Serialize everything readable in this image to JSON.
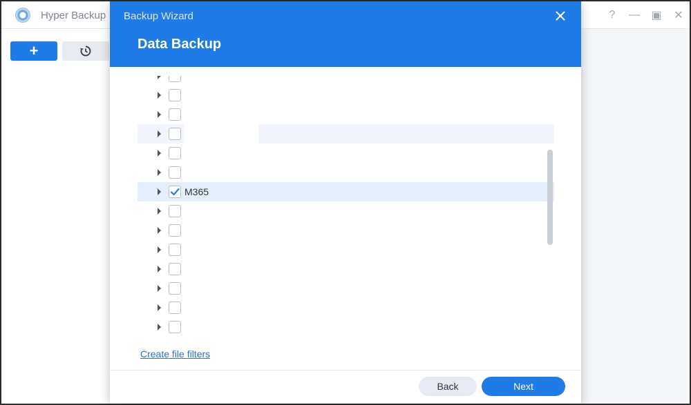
{
  "app": {
    "title": "Hyper Backup",
    "window_controls": [
      "?",
      "—",
      "▣",
      "✕"
    ],
    "sidebar": {
      "add_label": "+",
      "history_icon": "history-icon"
    }
  },
  "wizard": {
    "title": "Backup Wizard",
    "heading": "Data Backup",
    "close_icon": "close-icon",
    "tree_rows": [
      {
        "label": "",
        "checked": false,
        "state": "partial-top"
      },
      {
        "label": "",
        "checked": false
      },
      {
        "label": "",
        "checked": false
      },
      {
        "label": "",
        "checked": false,
        "state": "hover"
      },
      {
        "label": "",
        "checked": false
      },
      {
        "label": "",
        "checked": false
      },
      {
        "label": "M365",
        "checked": true,
        "state": "selected"
      },
      {
        "label": "",
        "checked": false
      },
      {
        "label": "",
        "checked": false
      },
      {
        "label": "",
        "checked": false
      },
      {
        "label": "",
        "checked": false
      },
      {
        "label": "",
        "checked": false
      },
      {
        "label": "",
        "checked": false
      },
      {
        "label": "",
        "checked": false,
        "state": "partial-bottom"
      }
    ],
    "filters_link": "Create file filters",
    "back_label": "Back",
    "next_label": "Next"
  },
  "colors": {
    "accent": "#1f7be6",
    "selected_row": "#e5eefb",
    "hover_row": "#f2f6fc",
    "link": "#2f6fc7"
  }
}
